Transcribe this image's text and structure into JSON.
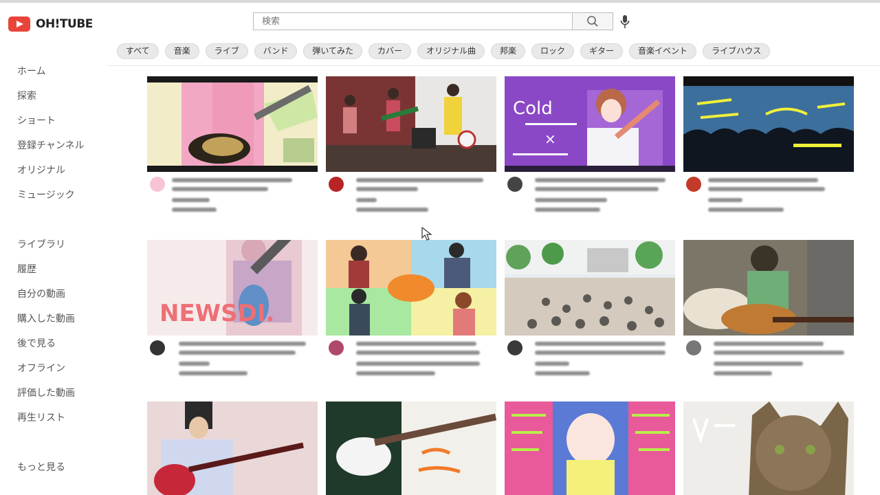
{
  "app": {
    "name": "OH!TUBE",
    "brand_color": "#e8443a"
  },
  "search": {
    "placeholder": "検索",
    "icon": "search-icon",
    "mic_icon": "mic-icon"
  },
  "chips": [
    "すべて",
    "音楽",
    "ライブ",
    "バンド",
    "弾いてみた",
    "カバー",
    "オリジナル曲",
    "邦楽",
    "ロック",
    "ギター",
    "音楽イベント",
    "ライブハウス"
  ],
  "sidebar": {
    "main": [
      "ホーム",
      "探索",
      "ショート",
      "登録チャンネル",
      "オリジナル",
      "ミュージック"
    ],
    "library": [
      "ライブラリ",
      "履歴",
      "自分の動画",
      "購入した動画",
      "後で見る",
      "オフライン",
      "評価した動画",
      "再生リスト"
    ],
    "more": "もっと見る"
  },
  "videos": [
    {
      "thumb_text": "",
      "theme": "guitar-close-up"
    },
    {
      "thumb_text": "",
      "theme": "band-on-stage"
    },
    {
      "thumb_text": "Cold ×",
      "theme": "singer-purple"
    },
    {
      "thumb_text": "",
      "theme": "concert-crowd"
    },
    {
      "thumb_text": "NEWSDI.",
      "theme": "bassist-pink"
    },
    {
      "thumb_text": "",
      "theme": "four-member-collage"
    },
    {
      "thumb_text": "",
      "theme": "outdoor-festival"
    },
    {
      "thumb_text": "",
      "theme": "acoustic-guitarist"
    },
    {
      "thumb_text": "",
      "theme": "electric-guitar-girl"
    },
    {
      "thumb_text": "",
      "theme": "white-guitar-player"
    },
    {
      "thumb_text": "",
      "theme": "anime-girl-pink"
    },
    {
      "thumb_text": "",
      "theme": "cat"
    }
  ]
}
